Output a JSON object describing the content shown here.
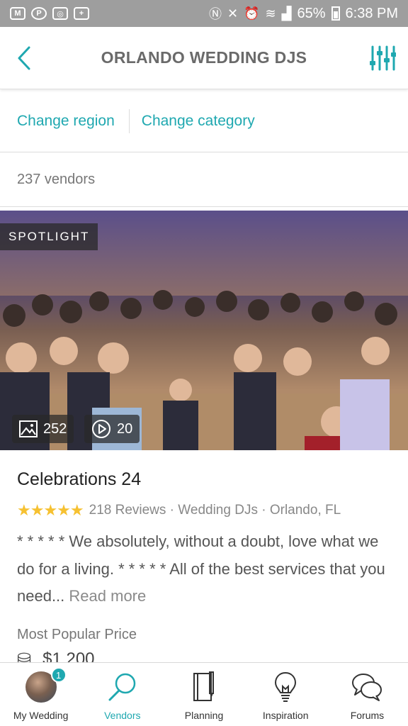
{
  "status_bar": {
    "battery": "65%",
    "time": "6:38 PM"
  },
  "header": {
    "title": "ORLANDO WEDDING DJS"
  },
  "filters": {
    "change_region": "Change region",
    "change_category": "Change category"
  },
  "results": {
    "count": "237 vendors"
  },
  "vendor": {
    "spotlight": "SPOTLIGHT",
    "photos_count": "252",
    "videos_count": "20",
    "name": "Celebrations 24",
    "rating_stars": 5,
    "reviews": "218 Reviews",
    "category": "Wedding DJs",
    "location": "Orlando, FL",
    "description": "* * * * * We absolutely, without a doubt, love what we do for a living. * * * * * All of the best services that you need...",
    "read_more": "Read more",
    "price_label": "Most Popular Price",
    "price_value": "$1,200"
  },
  "bottom_nav": {
    "items": [
      {
        "label": "My Wedding",
        "badge": "1"
      },
      {
        "label": "Vendors"
      },
      {
        "label": "Planning"
      },
      {
        "label": "Inspiration"
      },
      {
        "label": "Forums"
      }
    ]
  },
  "colors": {
    "accent": "#1fa8b0",
    "star": "#f6c131",
    "status_bar": "#9e9e9e"
  }
}
